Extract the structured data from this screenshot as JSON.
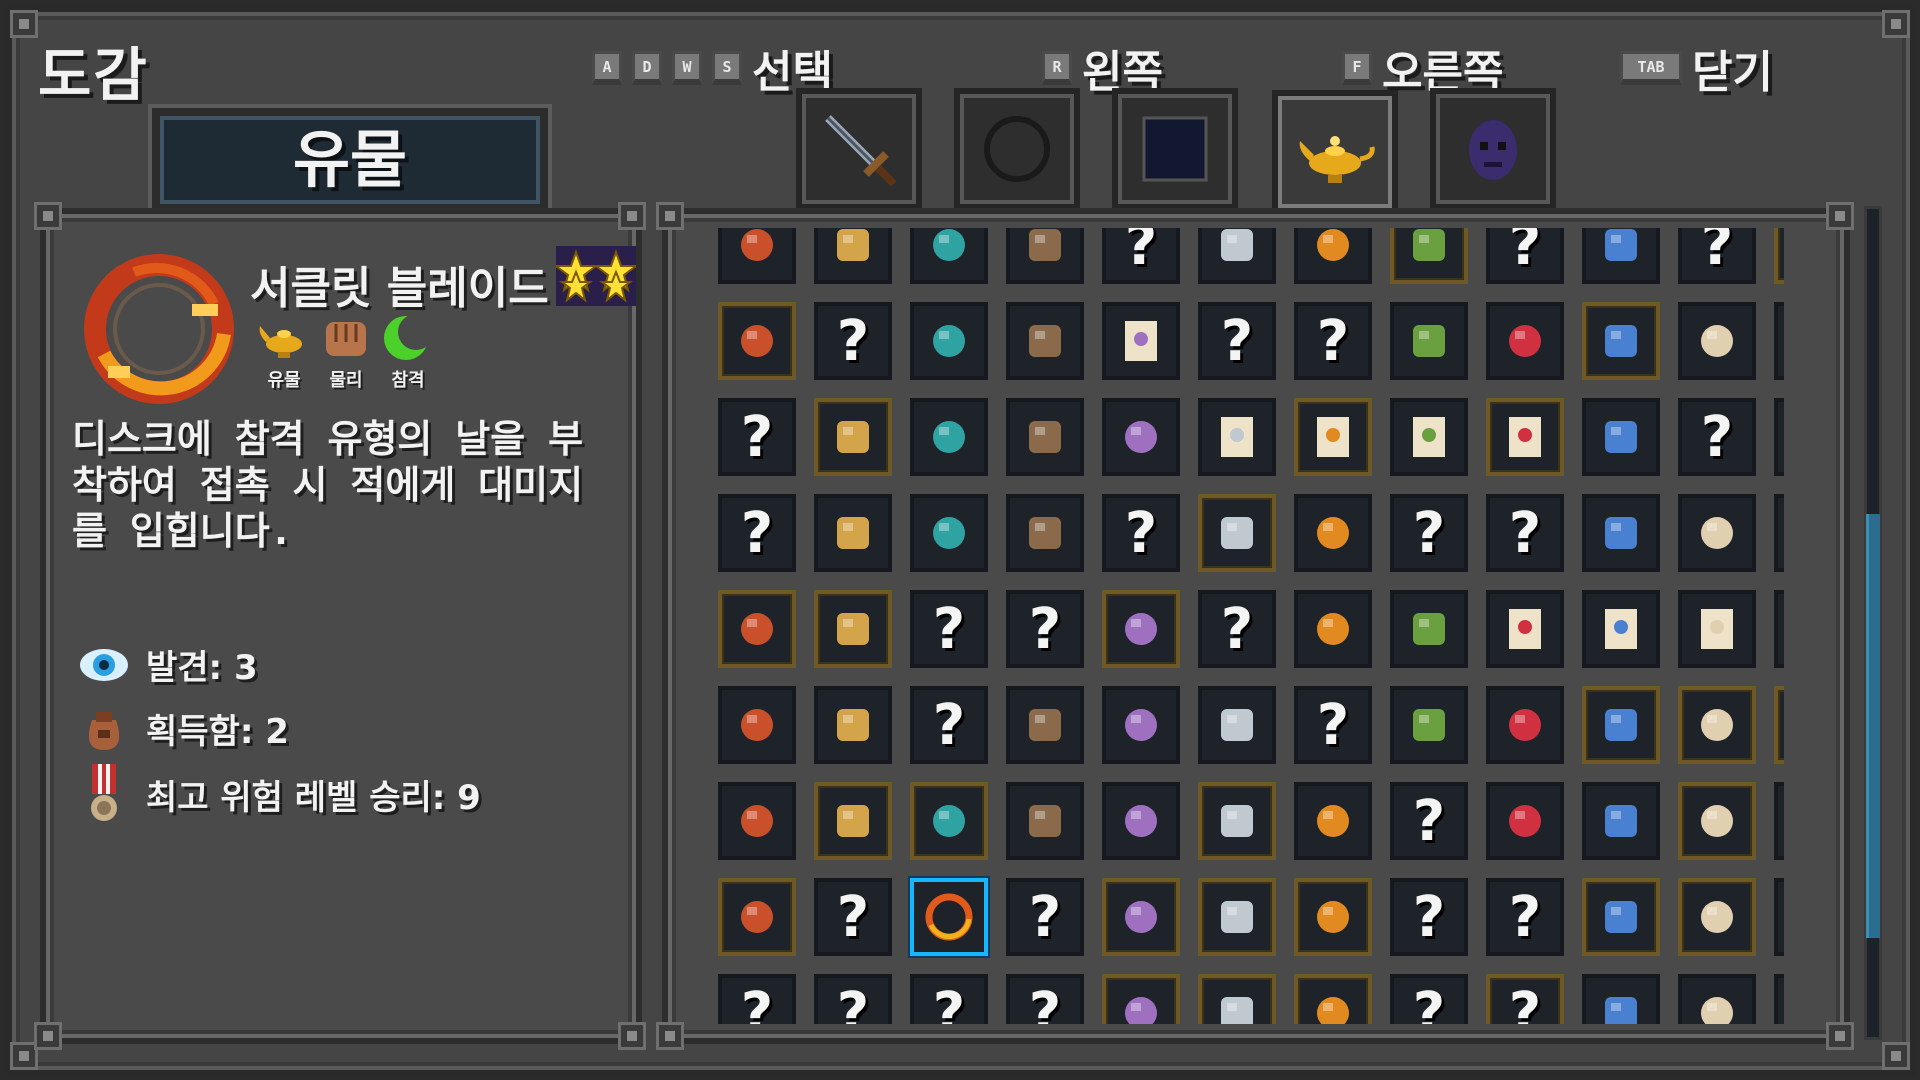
{
  "header": {
    "title": "도감",
    "hints": [
      {
        "keys": [
          "A",
          "D",
          "W",
          "S"
        ],
        "label": "선택"
      },
      {
        "keys": [
          "R"
        ],
        "label": "왼쪽"
      },
      {
        "keys": [
          "F"
        ],
        "label": "오른쪽"
      },
      {
        "keys": [
          "TAB"
        ],
        "label": "닫기"
      }
    ]
  },
  "category": {
    "label": "유물"
  },
  "tabs": [
    {
      "icon": "sword-icon",
      "active": false
    },
    {
      "icon": "ring-icon",
      "active": false
    },
    {
      "icon": "dark-square-icon",
      "active": false
    },
    {
      "icon": "genie-lamp-icon",
      "active": true
    },
    {
      "icon": "purple-mask-icon",
      "active": false
    }
  ],
  "detail": {
    "name": "서클릿 블레이드",
    "stars": 2,
    "icon": "circlet-blade-icon",
    "tags": [
      {
        "icon": "genie-lamp-icon",
        "label": "유물"
      },
      {
        "icon": "fist-icon",
        "label": "물리"
      },
      {
        "icon": "crescent-icon",
        "label": "참격"
      }
    ],
    "description": "디스크에 참격 유형의 날을 부착하여 접촉 시 적에게 대미지를 입힙니다.",
    "stats": [
      {
        "icon": "eye-icon",
        "text": "발견: 3"
      },
      {
        "icon": "loot-bag-icon",
        "text": "획득함: 2"
      },
      {
        "icon": "medal-icon",
        "text": "최고 위험 레벨 승리: 9"
      }
    ]
  },
  "grid": {
    "unknown_label": "?",
    "rows": [
      [
        "helmet",
        "claws",
        "skull",
        "beetle",
        "?",
        "nugget",
        "totem",
        "mask",
        "?",
        "bear",
        "?",
        "?"
      ],
      [
        "rune-ring",
        "?",
        "ticket",
        "spellbook",
        "banner",
        "?",
        "?",
        "crystal",
        "staff",
        "compass",
        "orb",
        "shuriken"
      ],
      [
        "?",
        "herb",
        "fire-wand",
        "ice-wand",
        "gold-wand",
        "banner",
        "banner",
        "banner",
        "banner",
        "hood-red",
        "?",
        "spear"
      ],
      [
        "?",
        "amulet",
        "chest",
        "pepper",
        "?",
        "backpack",
        "boot",
        "?",
        "?",
        "flail",
        "horns",
        "axe"
      ],
      [
        "spell-disc",
        "bow",
        "?",
        "?",
        "shell",
        "?",
        "wizard-hat",
        "rapier",
        "banner",
        "banner",
        "banner",
        "?"
      ],
      [
        "cloak",
        "shield",
        "?",
        "whip",
        "sling",
        "gauntlet",
        "?",
        "cube",
        "crest",
        "leaf",
        "bomb",
        "pot"
      ],
      [
        "crown",
        "fire-claws",
        "arrows",
        "beans",
        "potion",
        "kite",
        "lantern",
        "?",
        "eye-ring",
        "bat",
        "paw",
        "?"
      ],
      [
        "scroll",
        "?",
        "circlet-blade",
        "?",
        "hammer",
        "goblin",
        "armor",
        "?",
        "?",
        "tiki",
        "mushroom",
        "?"
      ],
      [
        "?",
        "?",
        "?",
        "?",
        "lamp-red",
        "seal",
        "coins",
        "?",
        "?",
        "frog",
        "flower",
        "lizard"
      ]
    ],
    "gold_frames": [
      [
        0,
        7
      ],
      [
        0,
        11
      ],
      [
        1,
        0
      ],
      [
        1,
        9
      ],
      [
        2,
        1
      ],
      [
        2,
        6
      ],
      [
        2,
        8
      ],
      [
        3,
        5
      ],
      [
        4,
        0
      ],
      [
        4,
        1
      ],
      [
        4,
        4
      ],
      [
        5,
        9
      ],
      [
        5,
        10
      ],
      [
        5,
        11
      ],
      [
        6,
        1
      ],
      [
        6,
        2
      ],
      [
        6,
        5
      ],
      [
        6,
        10
      ],
      [
        7,
        0
      ],
      [
        7,
        4
      ],
      [
        7,
        5
      ],
      [
        7,
        6
      ],
      [
        7,
        9
      ],
      [
        7,
        10
      ],
      [
        8,
        4
      ],
      [
        8,
        5
      ],
      [
        8,
        6
      ],
      [
        8,
        8
      ]
    ],
    "selected": [
      7,
      2
    ]
  }
}
